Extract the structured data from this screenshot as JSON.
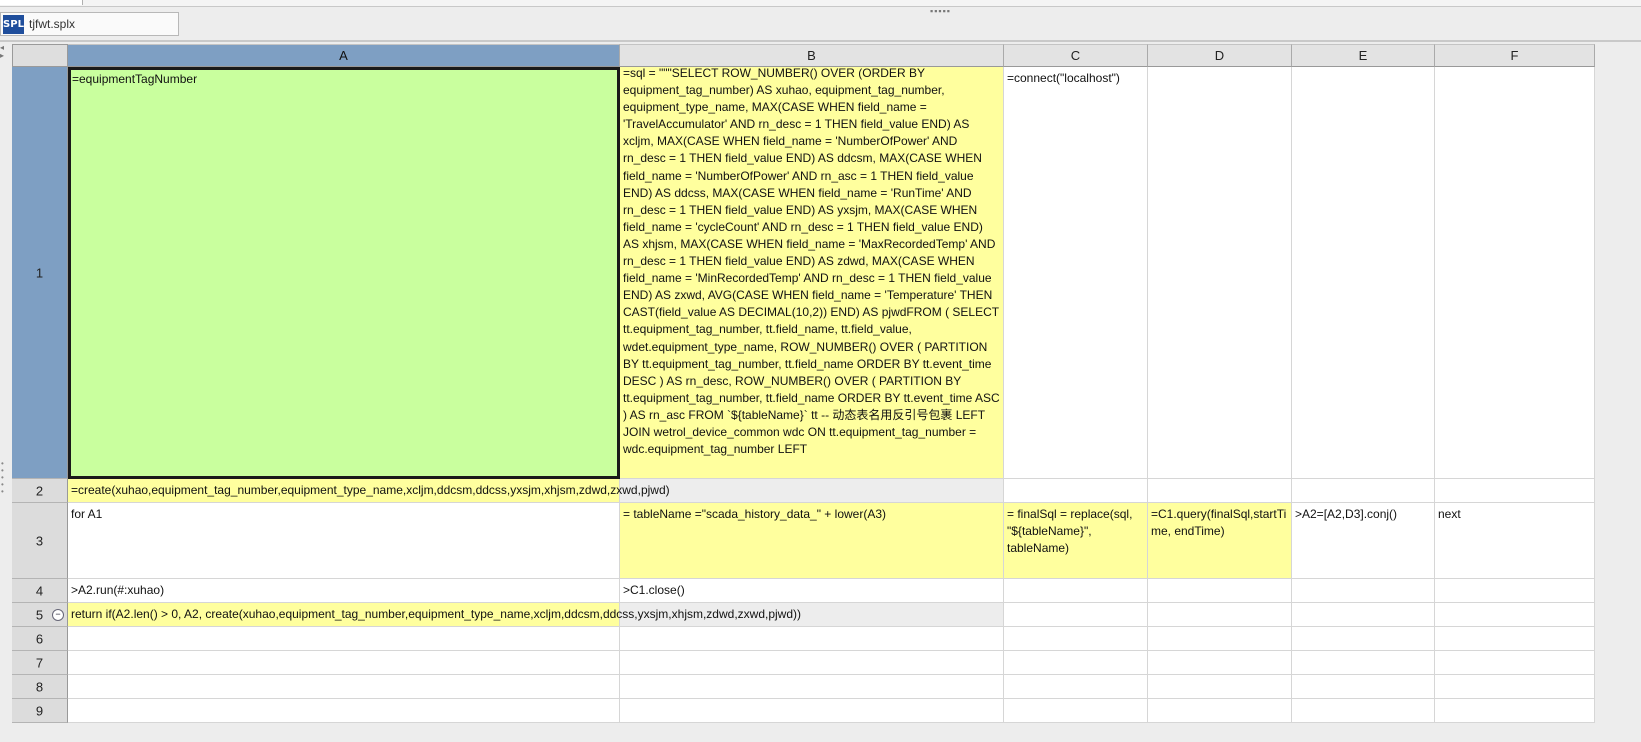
{
  "file_tab": {
    "icon_label": "SPL",
    "filename": "tjfwt.splx"
  },
  "columns": [
    "A",
    "B",
    "C",
    "D",
    "E",
    "F"
  ],
  "rows": [
    "1",
    "2",
    "3",
    "4",
    "5",
    "6",
    "7",
    "8",
    "9"
  ],
  "selected_cell": "A1",
  "colors": {
    "selection_header": "#7e9fc3",
    "constant_cell": "#c9ff9e",
    "expression_cell": "#ffff9e"
  },
  "cells": {
    "A1": "=equipmentTagNumber",
    "B1": "=sql = \"\"\"SELECT     ROW_NUMBER() OVER (ORDER BY equipment_tag_number) AS xuhao,    equipment_tag_number,    equipment_type_name,    MAX(CASE WHEN field_name = 'TravelAccumulator' AND rn_desc = 1 THEN field_value END) AS xcljm,    MAX(CASE WHEN field_name = 'NumberOfPower' AND rn_desc = 1 THEN field_value END) AS ddcsm,    MAX(CASE WHEN field_name = 'NumberOfPower' AND rn_asc = 1 THEN field_value END) AS ddcss,    MAX(CASE WHEN field_name = 'RunTime' AND rn_desc = 1 THEN field_value END) AS yxsjm,    MAX(CASE WHEN field_name = 'cycleCount' AND rn_desc = 1 THEN field_value END) AS xhjsm,    MAX(CASE WHEN field_name = 'MaxRecordedTemp' AND rn_desc = 1 THEN field_value END) AS zdwd,    MAX(CASE WHEN field_name = 'MinRecordedTemp' AND rn_desc = 1 THEN field_value END) AS zxwd,    AVG(CASE WHEN field_name = 'Temperature' THEN CAST(field_value AS DECIMAL(10,2)) END) AS pjwdFROM (    SELECT        tt.equipment_tag_number,        tt.field_name,        tt.field_value,        wdet.equipment_type_name,        ROW_NUMBER() OVER (            PARTITION BY tt.equipment_tag_number, tt.field_name            ORDER BY tt.event_time DESC        ) AS rn_desc,        ROW_NUMBER() OVER (            PARTITION BY tt.equipment_tag_number, tt.field_name            ORDER BY tt.event_time ASC        ) AS rn_asc    FROM `${tableName}` tt -- 动态表名用反引号包裹    LEFT JOIN wetrol_device_common wdc        ON tt.equipment_tag_number = wdc.equipment_tag_number    LEFT",
    "C1": "=connect(\"localhost\")",
    "A2": "=create(xuhao,equipment_tag_number,equipment_type_name,xcljm,ddcsm,ddcss,yxsjm,xhjsm,zdwd,zxwd,pjwd)",
    "A3": "for A1",
    "B3": "= tableName =\"scada_history_data_\" + lower(A3)",
    "C3": "= finalSql = replace(sql, \"${tableName}\", tableName)",
    "D3": "=C1.query(finalSql,startTime, endTime)",
    "E3": ">A2=[A2,D3].conj()",
    "F3": "next",
    "A4": ">A2.run(#:xuhao)",
    "B4": ">C1.close()",
    "A5": "return if(A2.len() > 0, A2, create(xuhao,equipment_tag_number,equipment_type_name,xcljm,ddcsm,ddcss,yxsjm,xhjsm,zdwd,zxwd,pjwd))"
  }
}
